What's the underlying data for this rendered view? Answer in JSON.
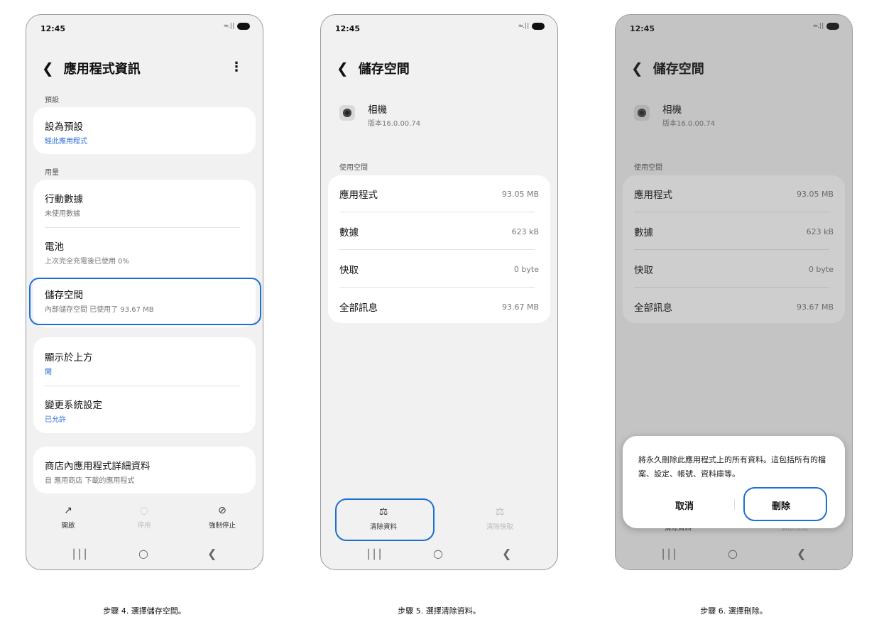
{
  "status": {
    "time": "12:45",
    "signal": "≈.∣∣"
  },
  "phone1": {
    "title": "應用程式資訊",
    "sections": {
      "defaults": "預設",
      "usage": "用量"
    },
    "set_default": {
      "title": "設為預設",
      "sub": "經此應用程式"
    },
    "mobile_data": {
      "title": "行動數據",
      "sub": "未使用數據"
    },
    "battery": {
      "title": "電池",
      "sub": "上次完全充電後已使用 0%"
    },
    "storage": {
      "title": "儲存空間",
      "sub": "內部儲存空間 已使用了 93.67 MB"
    },
    "display_over": {
      "title": "顯示於上方",
      "sub": "開"
    },
    "change_settings": {
      "title": "變更系統設定",
      "sub": "已允許"
    },
    "store_details": {
      "title": "商店內應用程式詳細資料",
      "sub": "自 應用商店 下載的應用程式"
    },
    "buttons": {
      "open": "開啟",
      "disable": "停用",
      "force_stop": "強制停止"
    }
  },
  "storage_page": {
    "title": "儲存空間",
    "app_name": "相機",
    "app_version": "版本16.0.00.74",
    "section": "使用空間",
    "rows": [
      {
        "label": "應用程式",
        "value": "93.05 MB"
      },
      {
        "label": "數據",
        "value": "623 kB"
      },
      {
        "label": "快取",
        "value": "0 byte"
      },
      {
        "label": "全部訊息",
        "value": "93.67 MB"
      }
    ],
    "buttons": {
      "clear_data": "清除資料",
      "clear_cache": "清除快取"
    }
  },
  "dialog": {
    "message": "將永久刪除此應用程式上的所有資料。這包括所有的檔案、設定、帳號、資料庫等。",
    "cancel": "取消",
    "delete": "刪除"
  },
  "captions": {
    "step4": "步驟 4. 選擇儲存空間。",
    "step5": "步驟 5. 選擇清除資料。",
    "step6": "步驟 6. 選擇刪除。"
  },
  "colors": {
    "highlight": "#1d6fd1",
    "link_blue": "#2f6fd6"
  }
}
